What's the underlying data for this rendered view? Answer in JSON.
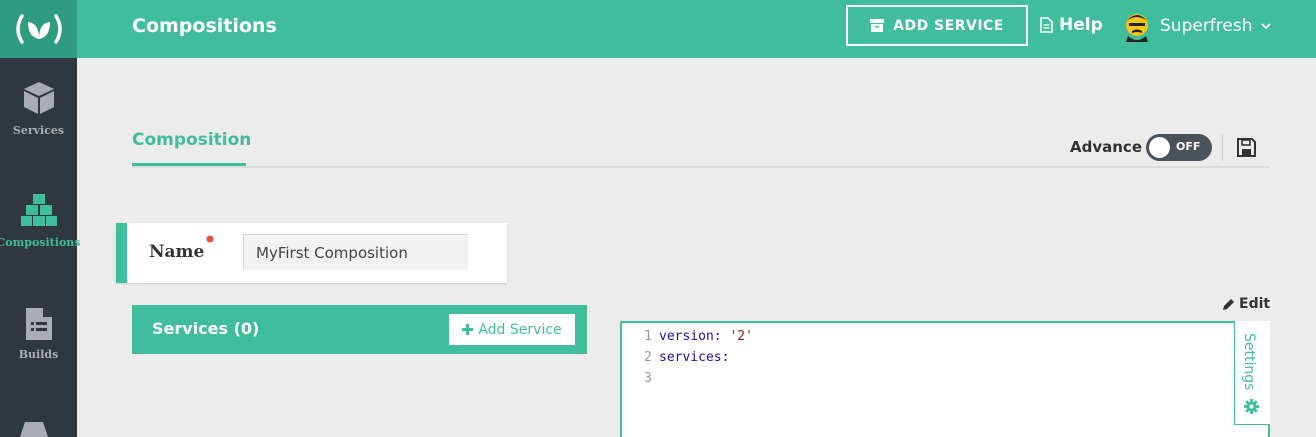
{
  "header": {
    "page_title": "Compositions",
    "add_service_label": "ADD SERVICE",
    "help_label": "Help",
    "user_name": "Superfresh"
  },
  "sidebar": {
    "items": [
      {
        "label": "Services",
        "icon": "cube-icon"
      },
      {
        "label": "Compositions",
        "icon": "cubes-icon",
        "active": true
      },
      {
        "label": "Builds",
        "icon": "document-icon"
      }
    ]
  },
  "tabs": {
    "composition": "Composition"
  },
  "toolbar": {
    "advance_label": "Advance",
    "toggle_state": "OFF"
  },
  "name_field": {
    "label": "Name",
    "value": "MyFirst Composition"
  },
  "services_panel": {
    "title": "Services (0)",
    "add_label": "Add Service"
  },
  "editor": {
    "edit_label": "Edit",
    "lines": [
      {
        "num": "1",
        "key": "version:",
        "value": " '2'"
      },
      {
        "num": "2",
        "key": "services:",
        "value": ""
      },
      {
        "num": "3",
        "key": "",
        "value": ""
      }
    ],
    "settings_label": "Settings"
  },
  "colors": {
    "brand": "#40bd9b",
    "sidebar": "#2f3841",
    "logo_bg": "#2f9c7e"
  }
}
